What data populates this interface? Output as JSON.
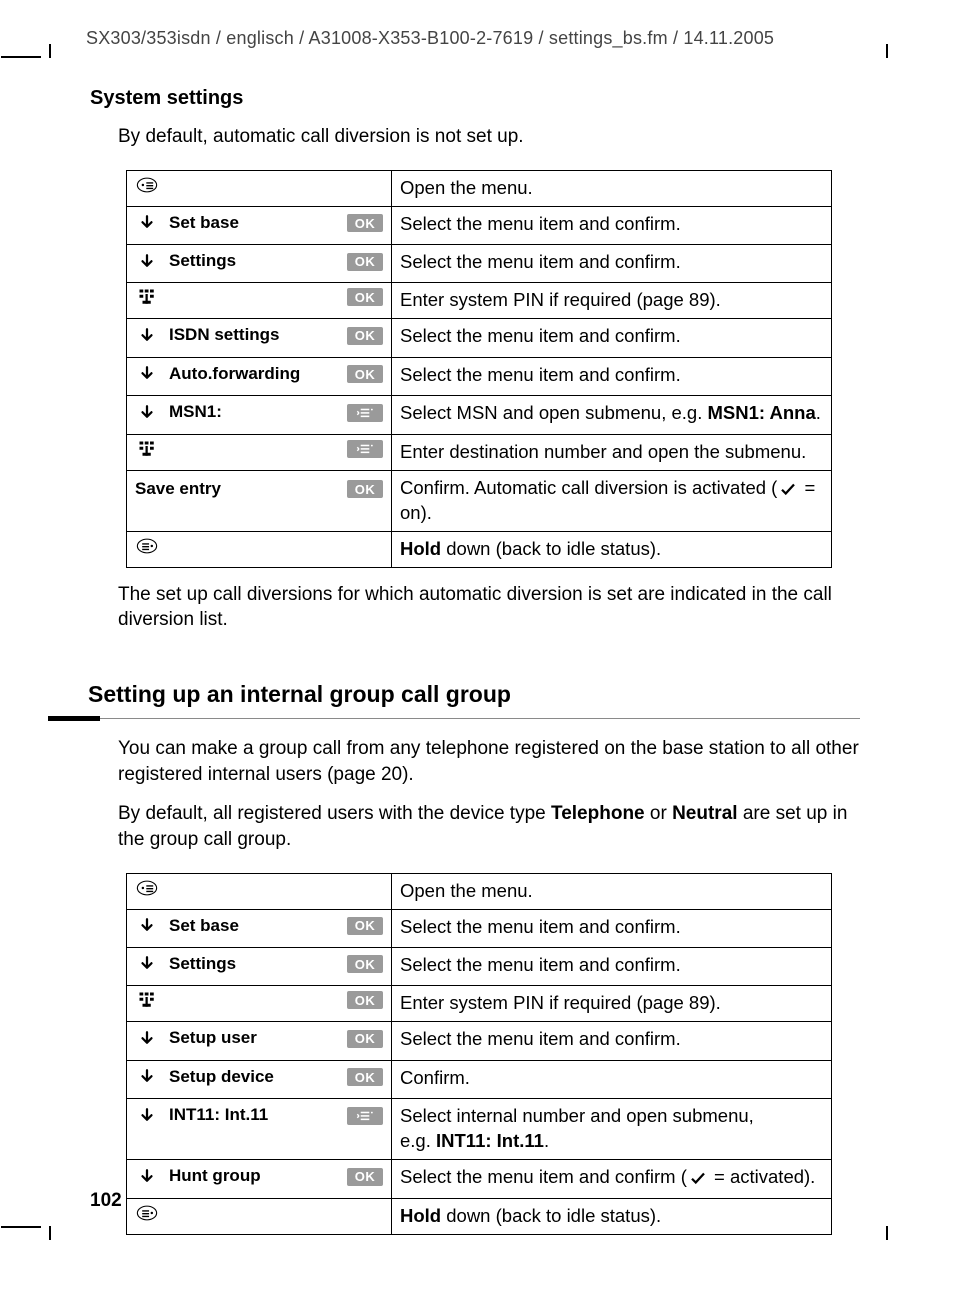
{
  "header_path": "SX303/353isdn / englisch / A31008-X353-B100-2-7619 / settings_bs.fm / 14.11.2005",
  "running_head": "System settings",
  "intro1": "By default, automatic call diversion is not set up.",
  "table1": {
    "rows": [
      {
        "left_type": "menu-open",
        "desc_plain": "Open the menu."
      },
      {
        "left_type": "down-ok",
        "label": "Set base",
        "desc_plain": "Select the menu item and confirm."
      },
      {
        "left_type": "down-ok",
        "label": "Settings",
        "desc_plain": "Select the menu item and confirm."
      },
      {
        "left_type": "keypad-ok",
        "desc_html": "Enter system PIN if required (page 89)."
      },
      {
        "left_type": "down-ok",
        "label": "ISDN settings",
        "desc_plain": "Select the menu item and confirm."
      },
      {
        "left_type": "down-ok",
        "label": "Auto.forwarding",
        "desc_plain": "Select the menu item and confirm."
      },
      {
        "left_type": "down-sub",
        "label": "MSN1:",
        "desc_html": "Select MSN and open submenu, e.g. <b>MSN1: Anna</b>."
      },
      {
        "left_type": "keypad-sub",
        "desc_plain": "Enter destination number and open the submenu."
      },
      {
        "left_type": "save-ok",
        "label": "Save entry",
        "desc_html": "Confirm. Automatic call diversion is activated (<svg class='ico' viewBox='0 0 24 24'><path d='M4 13 L9 18 L20 6' fill='none' stroke='#000' stroke-width='3'/></svg> = on)."
      },
      {
        "left_type": "hold",
        "desc_html": "<b>Hold</b> down (back to idle status)."
      }
    ]
  },
  "after_table1": "The set up call diversions for which automatic diversion is set are indicated in the call diversion list.",
  "section2_title": "Setting up an internal group call group",
  "section2_p1": "You can make a group call from any telephone registered on the base station to all other registered internal users (page 20).",
  "section2_p2_html": "By default, all registered users with the device type <b>Telephone</b> or <b>Neutral</b> are set up in the group call group.",
  "table2": {
    "rows": [
      {
        "left_type": "menu-open",
        "desc_plain": "Open the menu."
      },
      {
        "left_type": "down-ok",
        "label": "Set base",
        "desc_plain": "Select the menu item and confirm."
      },
      {
        "left_type": "down-ok",
        "label": "Settings",
        "desc_plain": "Select the menu item and confirm."
      },
      {
        "left_type": "keypad-ok",
        "desc_html": "Enter system PIN if required (page 89)."
      },
      {
        "left_type": "down-ok",
        "label": "Setup user",
        "desc_plain": "Select the menu item and confirm."
      },
      {
        "left_type": "down-ok",
        "label": "Setup device",
        "desc_plain": "Confirm."
      },
      {
        "left_type": "down-sub",
        "label": "INT11: Int.11",
        "desc_html": "Select internal number and open submenu, e.g.&nbsp;<b>INT11: Int.11</b>."
      },
      {
        "left_type": "down-ok",
        "label": "Hunt group",
        "desc_html": "Select the menu item and confirm (<svg class='ico' viewBox='0 0 24 24'><path d='M4 13 L9 18 L20 6' fill='none' stroke='#000' stroke-width='3'/></svg> = activated)."
      },
      {
        "left_type": "hold",
        "desc_html": "<b>Hold</b> down (back to idle status)."
      }
    ]
  },
  "page_number": "102",
  "badges": {
    "ok": "OK"
  }
}
